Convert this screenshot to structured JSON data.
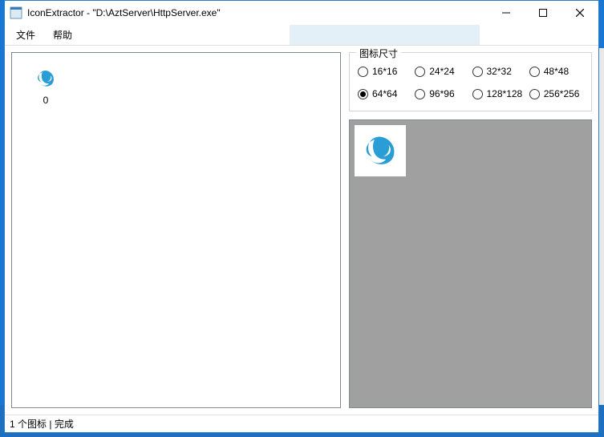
{
  "window": {
    "title": "IconExtractor - \"D:\\AztServer\\HttpServer.exe\""
  },
  "menu": {
    "file": "文件",
    "help": "帮助"
  },
  "iconList": {
    "items": [
      {
        "index_label": "0"
      }
    ]
  },
  "sizes": {
    "group_label": "图标尺寸",
    "options": [
      {
        "label": "16*16",
        "selected": false
      },
      {
        "label": "24*24",
        "selected": false
      },
      {
        "label": "32*32",
        "selected": false
      },
      {
        "label": "48*48",
        "selected": false
      },
      {
        "label": "64*64",
        "selected": true
      },
      {
        "label": "96*96",
        "selected": false
      },
      {
        "label": "128*128",
        "selected": false
      },
      {
        "label": "256*256",
        "selected": false
      }
    ]
  },
  "status": {
    "count_text": "1 个图标",
    "separator": "|",
    "state_text": "完成"
  },
  "icons": {
    "app_swirl_color": "#2a9cd6"
  }
}
